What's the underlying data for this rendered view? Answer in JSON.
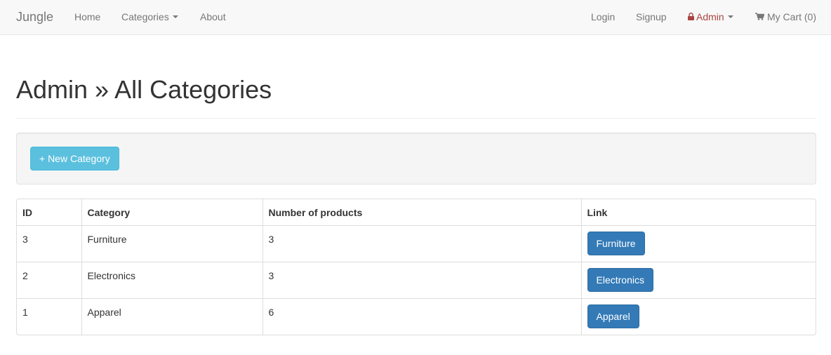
{
  "navbar": {
    "brand": "Jungle",
    "left": [
      {
        "label": "Home"
      },
      {
        "label": "Categories"
      },
      {
        "label": "About"
      }
    ],
    "right": {
      "login": "Login",
      "signup": "Signup",
      "admin": "Admin",
      "cart": "My Cart (0)"
    }
  },
  "page": {
    "title": "Admin » All Categories",
    "new_button": "+ New Category"
  },
  "table": {
    "headers": [
      "ID",
      "Category",
      "Number of products",
      "Link"
    ],
    "rows": [
      {
        "id": "3",
        "category": "Furniture",
        "count": "3",
        "link": "Furniture"
      },
      {
        "id": "2",
        "category": "Electronics",
        "count": "3",
        "link": "Electronics"
      },
      {
        "id": "1",
        "category": "Apparel",
        "count": "6",
        "link": "Apparel"
      }
    ]
  },
  "colors": {
    "navbar_bg": "#f8f8f8",
    "admin_red": "#a94442",
    "info_button": "#5bc0de",
    "primary_button": "#337ab7"
  },
  "icons": {
    "admin": "lock-icon",
    "cart": "shopping-cart-icon",
    "dropdown": "caret-down-icon"
  }
}
